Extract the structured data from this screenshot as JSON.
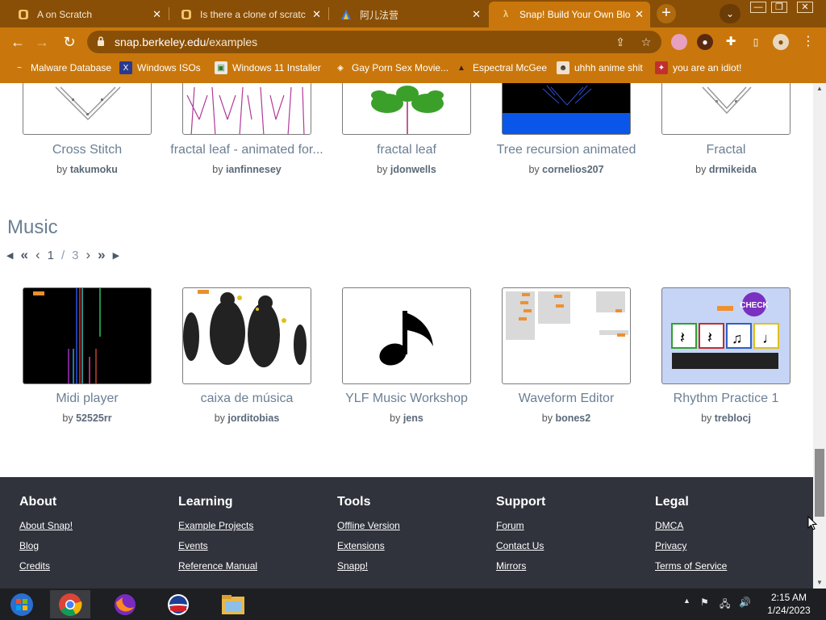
{
  "tabs": [
    {
      "title": "A on Scratch",
      "state": "inactive"
    },
    {
      "title": "Is there a clone of scratc",
      "state": "inactive"
    },
    {
      "title": "阿儿法营",
      "state": "inactive"
    },
    {
      "title": "Snap! Build Your Own Blo",
      "state": "active"
    }
  ],
  "address": {
    "domain": "snap.berkeley.edu",
    "path": "/examples"
  },
  "bookmarks": [
    {
      "label": "Malware Database"
    },
    {
      "label": "Windows ISOs"
    },
    {
      "label": "Windows 11 Installer"
    },
    {
      "label": "Gay Porn Sex Movie..."
    },
    {
      "label": "Espectral McGee"
    },
    {
      "label": "uhhh anime shit"
    },
    {
      "label": "you are an idiot!"
    }
  ],
  "top_row": [
    {
      "title": "Cross Stitch",
      "author": "takumoku"
    },
    {
      "title": "fractal leaf - animated for...",
      "author": "ianfinnesey"
    },
    {
      "title": "fractal leaf",
      "author": "jdonwells"
    },
    {
      "title": "Tree recursion animated",
      "author": "cornelios207"
    },
    {
      "title": "Fractal",
      "author": "drmikeida"
    }
  ],
  "music": {
    "heading": "Music",
    "page": "1",
    "sep": "/",
    "total": "3",
    "items": [
      {
        "title": "Midi player",
        "author": "52525rr"
      },
      {
        "title": "caixa de música",
        "author": "jorditobias"
      },
      {
        "title": "YLF Music Workshop",
        "author": "jens"
      },
      {
        "title": "Waveform Editor",
        "author": "bones2"
      },
      {
        "title": "Rhythm Practice 1",
        "author": "treblocj"
      }
    ]
  },
  "by_label": "by",
  "footer": {
    "columns": [
      {
        "heading": "About",
        "links": [
          "About Snap!",
          "Blog",
          "Credits"
        ]
      },
      {
        "heading": "Learning",
        "links": [
          "Example Projects",
          "Events",
          "Reference Manual"
        ]
      },
      {
        "heading": "Tools",
        "links": [
          "Offline Version",
          "Extensions",
          "Snapp!"
        ]
      },
      {
        "heading": "Support",
        "links": [
          "Forum",
          "Contact Us",
          "Mirrors"
        ]
      },
      {
        "heading": "Legal",
        "links": [
          "DMCA",
          "Privacy",
          "Terms of Service"
        ]
      }
    ]
  },
  "clock": {
    "time": "2:15 AM",
    "date": "1/24/2023"
  },
  "thumb_labels": {
    "check": "CHECK"
  },
  "colors": {
    "browser_frame": "#c9770c",
    "tabstrip": "#8a4f06",
    "footer": "#30323c",
    "link_title": "#6b7f94"
  }
}
